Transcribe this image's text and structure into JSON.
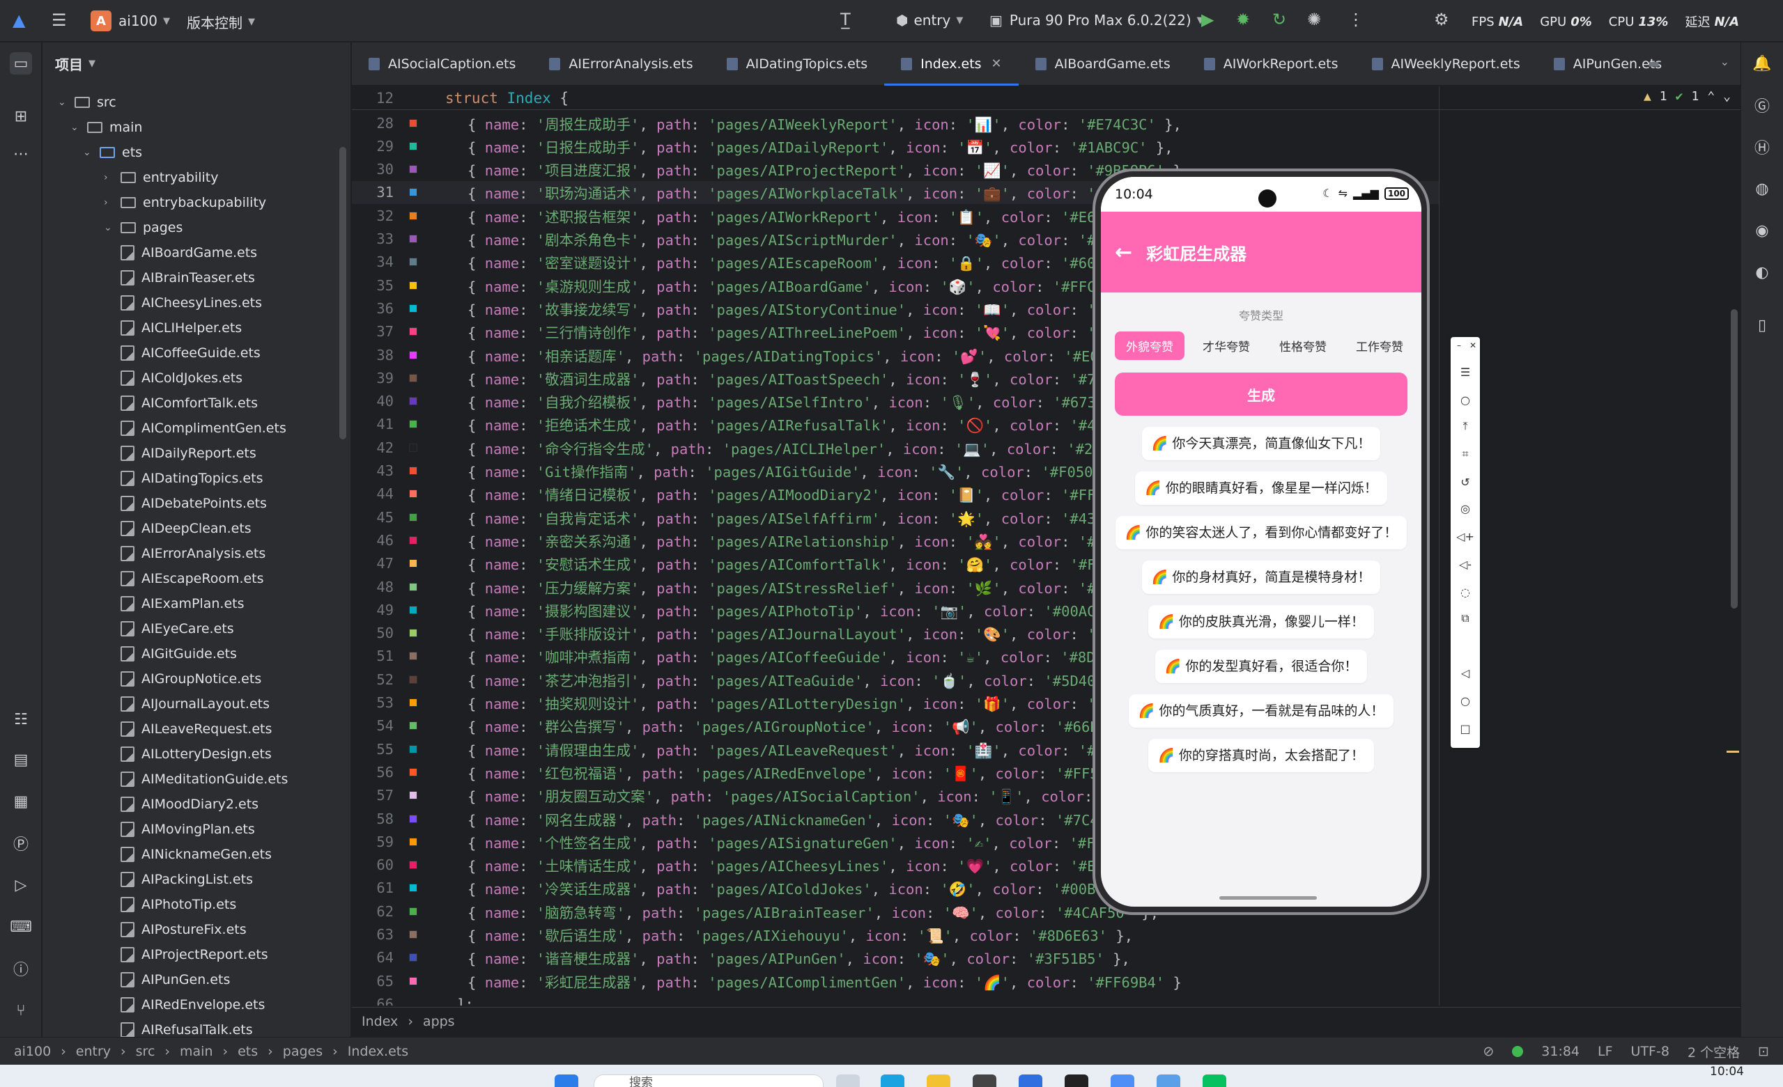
{
  "titlebar": {
    "project_badge": "A",
    "project_name": "ai100",
    "vcs": "版本控制",
    "run_config": "entry",
    "device": "Pura 90 Pro Max 6.0.2(22)",
    "fps_label": "FPS",
    "fps_value": "N/A",
    "gpu_label": "GPU",
    "gpu_value": "0%",
    "cpu_label": "CPU",
    "cpu_value": "13%",
    "latency_label": "延迟",
    "latency_value": "N/A"
  },
  "project_panel": {
    "title": "项目",
    "folders": [
      {
        "label": "src",
        "depth": 0,
        "expanded": true
      },
      {
        "label": "main",
        "depth": 1,
        "expanded": true
      },
      {
        "label": "ets",
        "depth": 2,
        "expanded": true
      },
      {
        "label": "entryability",
        "depth": 3,
        "expanded": false
      },
      {
        "label": "entrybackupability",
        "depth": 3,
        "expanded": false
      },
      {
        "label": "pages",
        "depth": 3,
        "expanded": true
      }
    ],
    "files": [
      "AIBoardGame.ets",
      "AIBrainTeaser.ets",
      "AICheesyLines.ets",
      "AICLIHelper.ets",
      "AICoffeeGuide.ets",
      "AIColdJokes.ets",
      "AIComfortTalk.ets",
      "AIComplimentGen.ets",
      "AIDailyReport.ets",
      "AIDatingTopics.ets",
      "AIDebatePoints.ets",
      "AIDeepClean.ets",
      "AIErrorAnalysis.ets",
      "AIEscapeRoom.ets",
      "AIExamPlan.ets",
      "AIEyeCare.ets",
      "AIGitGuide.ets",
      "AIGroupNotice.ets",
      "AIJournalLayout.ets",
      "AILeaveRequest.ets",
      "AILotteryDesign.ets",
      "AIMeditationGuide.ets",
      "AIMoodDiary2.ets",
      "AIMovingPlan.ets",
      "AINicknameGen.ets",
      "AIPackingList.ets",
      "AIPhotoTip.ets",
      "AIPostureFix.ets",
      "AIProjectReport.ets",
      "AIPunGen.ets",
      "AIRedEnvelope.ets",
      "AIRefusalTalk.ets"
    ]
  },
  "tabs": [
    {
      "label": "AISocialCaption.ets",
      "active": false
    },
    {
      "label": "AIErrorAnalysis.ets",
      "active": false
    },
    {
      "label": "AIDatingTopics.ets",
      "active": false
    },
    {
      "label": "Index.ets",
      "active": true
    },
    {
      "label": "AIBoardGame.ets",
      "active": false
    },
    {
      "label": "AIWorkReport.ets",
      "active": false
    },
    {
      "label": "AIWeeklyReport.ets",
      "active": false
    },
    {
      "label": "AIPunGen.ets",
      "active": false
    }
  ],
  "editor": {
    "sticky_line_number": "12",
    "sticky_kw": "struct",
    "sticky_name": "Index",
    "sticky_brace": "{",
    "warnings": "1",
    "checks": "1",
    "current_line": 31,
    "lines": [
      {
        "n": "28",
        "color": "#E74C3C",
        "text": "{ name: '周报生成助手', path: 'pages/AIWeeklyReport', icon: '📊', color: '#E74C3C' },"
      },
      {
        "n": "29",
        "color": "#1ABC9C",
        "text": "{ name: '日报生成助手', path: 'pages/AIDailyReport', icon: '📅', color: '#1ABC9C' },"
      },
      {
        "n": "30",
        "color": "#9B59B6",
        "text": "{ name: '项目进度汇报', path: 'pages/AIProjectReport', icon: '📈', color: '#9B59B6' },"
      },
      {
        "n": "31",
        "color": "#3498DB",
        "text": "{ name: '职场沟通话术', path: 'pages/AIWorkplaceTalk', icon: '💼', color: '#3498DB' },"
      },
      {
        "n": "32",
        "color": "#E67E22",
        "text": "{ name: '述职报告框架', path: 'pages/AIWorkReport', icon: '📋', color: '#E67E22' },"
      },
      {
        "n": "33",
        "color": "#9B59B6",
        "text": "{ name: '剧本杀角色卡', path: 'pages/AIScriptMurder', icon: '🎭', color: '#9B59B6' },"
      },
      {
        "n": "34",
        "color": "#607D8B",
        "text": "{ name: '密室谜题设计', path: 'pages/AIEscapeRoom', icon: '🔒', color: '#607D8B' },"
      },
      {
        "n": "35",
        "color": "#FFC107",
        "text": "{ name: '桌游规则生成', path: 'pages/AIBoardGame', icon: '🎲', color: '#FFC107' },"
      },
      {
        "n": "36",
        "color": "#00BCD4",
        "text": "{ name: '故事接龙续写', path: 'pages/AIStoryContinue', icon: '📖', color: '#00BCD4' },"
      },
      {
        "n": "37",
        "color": "#FF4081",
        "text": "{ name: '三行情诗创作', path: 'pages/AIThreeLinePoem', icon: '💘', color: '#FF4081' },"
      },
      {
        "n": "38",
        "color": "#E040FB",
        "text": "{ name: '相亲话题库', path: 'pages/AIDatingTopics', icon: '💕', color: '#E040FB' },"
      },
      {
        "n": "39",
        "color": "#795548",
        "text": "{ name: '敬酒词生成器', path: 'pages/AIToastSpeech', icon: '🍷', color: '#795548' },"
      },
      {
        "n": "40",
        "color": "#673AB7",
        "text": "{ name: '自我介绍模板', path: 'pages/AISelfIntro', icon: '🎙', color: '#673AB7' },"
      },
      {
        "n": "41",
        "color": "#4CAF50",
        "text": "{ name: '拒绝话术生成', path: 'pages/AIRefusalTalk', icon: '🚫', color: '#4CAF50' },"
      },
      {
        "n": "42",
        "color": "#212121",
        "text": "{ name: '命令行指令生成', path: 'pages/AICLIHelper', icon: '💻', color: '#212121' },"
      },
      {
        "n": "43",
        "color": "#F05032",
        "text": "{ name: 'Git操作指南', path: 'pages/AIGitGuide', icon: '🔧', color: '#F05032' },"
      },
      {
        "n": "44",
        "color": "#FF6F61",
        "text": "{ name: '情绪日记模板', path: 'pages/AIMoodDiary2', icon: '📔', color: '#FF6F61' },"
      },
      {
        "n": "45",
        "color": "#43A047",
        "text": "{ name: '自我肯定话术', path: 'pages/AISelfAffirm', icon: '🌟', color: '#43A047' },"
      },
      {
        "n": "46",
        "color": "#E91E63",
        "text": "{ name: '亲密关系沟通', path: 'pages/AIRelationship', icon: '💑', color: '#E91E63' },"
      },
      {
        "n": "47",
        "color": "#FFB74D",
        "text": "{ name: '安慰话术生成', path: 'pages/AIComfortTalk', icon: '🤗', color: '#FFB74D' },"
      },
      {
        "n": "48",
        "color": "#81C784",
        "text": "{ name: '压力缓解方案', path: 'pages/AIStressRelief', icon: '🌿', color: '#81C784' },"
      },
      {
        "n": "49",
        "color": "#00ACC1",
        "text": "{ name: '摄影构图建议', path: 'pages/AIPhotoTip', icon: '📷', color: '#00ACC1' },"
      },
      {
        "n": "50",
        "color": "#9CCC65",
        "text": "{ name: '手账排版设计', path: 'pages/AIJournalLayout', icon: '🎨', color: '#9CCC65' },"
      },
      {
        "n": "51",
        "color": "#8D6E63",
        "text": "{ name: '咖啡冲煮指南', path: 'pages/AICoffeeGuide', icon: '☕', color: '#8D6E63' },"
      },
      {
        "n": "52",
        "color": "#5D4037",
        "text": "{ name: '茶艺冲泡指引', path: 'pages/AITeaGuide', icon: '🍵', color: '#5D4037' },"
      },
      {
        "n": "53",
        "color": "#FFA000",
        "text": "{ name: '抽奖规则设计', path: 'pages/AILotteryDesign', icon: '🎁', color: '#FFA000' },"
      },
      {
        "n": "54",
        "color": "#66BB6A",
        "text": "{ name: '群公告撰写', path: 'pages/AIGroupNotice', icon: '📢', color: '#66BB6A' },"
      },
      {
        "n": "55",
        "color": "#0097A7",
        "text": "{ name: '请假理由生成', path: 'pages/AILeaveRequest', icon: '🏥', color: '#0097A7' },"
      },
      {
        "n": "56",
        "color": "#FF5722",
        "text": "{ name: '红包祝福语', path: 'pages/AIRedEnvelope', icon: '🧧', color: '#FF5722' },"
      },
      {
        "n": "57",
        "color": "#E1BEE7",
        "text": "{ name: '朋友圈互动文案', path: 'pages/AISocialCaption', icon: '📱', color: '#E1BEE7' },"
      },
      {
        "n": "58",
        "color": "#7C4DFF",
        "text": "{ name: '网名生成器', path: 'pages/AINicknameGen', icon: '🎭', color: '#7C4DFF' },"
      },
      {
        "n": "59",
        "color": "#FF9800",
        "text": "{ name: '个性签名生成', path: 'pages/AISignatureGen', icon: '✍', color: '#FF9800' },"
      },
      {
        "n": "60",
        "color": "#E91E63",
        "text": "{ name: '土味情话生成', path: 'pages/AICheesyLines', icon: '💗', color: '#E91E63' },"
      },
      {
        "n": "61",
        "color": "#00BCD4",
        "text": "{ name: '冷笑话生成器', path: 'pages/AIColdJokes', icon: '🤣', color: '#00BCD4' },"
      },
      {
        "n": "62",
        "color": "#4CAF50",
        "text": "{ name: '脑筋急转弯', path: 'pages/AIBrainTeaser', icon: '🧠', color: '#4CAF50' },"
      },
      {
        "n": "63",
        "color": "#8D6E63",
        "text": "{ name: '歇后语生成', path: 'pages/AIXiehouyu', icon: '📜', color: '#8D6E63' },"
      },
      {
        "n": "64",
        "color": "#3F51B5",
        "text": "{ name: '谐音梗生成器', path: 'pages/AIPunGen', icon: '🎭', color: '#3F51B5' },"
      },
      {
        "n": "65",
        "color": "#FF69B4",
        "text": "{ name: '彩虹屁生成器', path: 'pages/AIComplimentGen', icon: '🌈', color: '#FF69B4' }"
      },
      {
        "n": "66",
        "color": "",
        "text": "];"
      }
    ]
  },
  "editor_breadcrumb": [
    "Index",
    "apps"
  ],
  "statusbar": {
    "crumbs": [
      "ai100",
      "entry",
      "src",
      "main",
      "ets",
      "pages",
      "Index.ets"
    ],
    "position": "31:84",
    "line_sep": "LF",
    "encoding": "UTF-8",
    "indent": "2 个空格"
  },
  "taskbar": {
    "search_placeholder": "搜索",
    "time": "10:04"
  },
  "phone": {
    "time": "10:04",
    "battery": "100",
    "title": "彩虹屁生成器",
    "section_label": "夸赞类型",
    "types": [
      {
        "label": "外貌夸赞",
        "active": true
      },
      {
        "label": "才华夸赞",
        "active": false
      },
      {
        "label": "性格夸赞",
        "active": false
      },
      {
        "label": "工作夸赞",
        "active": false
      }
    ],
    "generate_label": "生成",
    "results": [
      "🌈 你今天真漂亮，简直像仙女下凡！",
      "🌈 你的眼睛真好看，像星星一样闪烁！",
      "🌈 你的笑容太迷人了，看到你心情都变好了！",
      "🌈 你的身材真好，简直是模特身材！",
      "🌈 你的皮肤真光滑，像婴儿一样！",
      "🌈 你的发型真好看，很适合你！",
      "🌈 你的气质真好，一看就是有品味的人！",
      "🌈 你的穿搭真时尚，太会搭配了！"
    ]
  },
  "colors": {
    "accent_pink": "#FF69B4",
    "ide_bg": "#1E1F22",
    "ide_panel": "#2B2D30",
    "active_tab_underline": "#3574F0"
  }
}
